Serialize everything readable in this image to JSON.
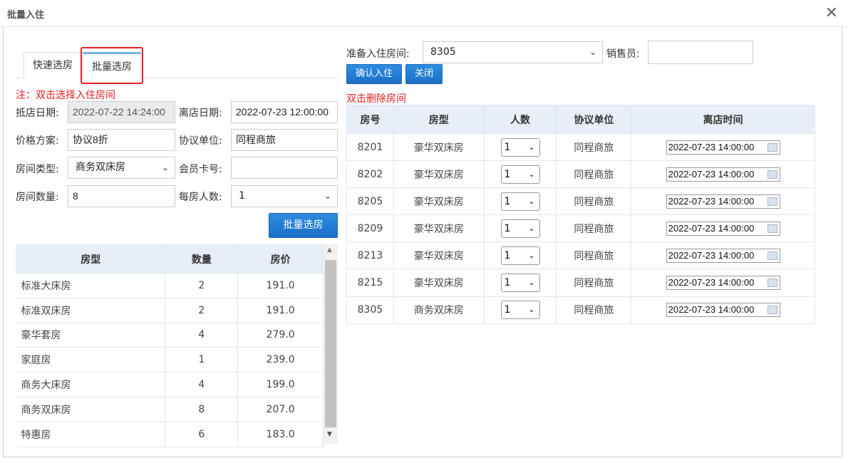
{
  "window": {
    "title": "批量入住"
  },
  "tabs": [
    {
      "label": "快速选房",
      "active": false
    },
    {
      "label": "批量选房",
      "active": true
    }
  ],
  "left": {
    "note": "注：双击选择入住房间",
    "checkin_label": "抵店日期:",
    "checkin_value": "2022-07-22 14:24:00",
    "checkout_label": "离店日期:",
    "checkout_value": "2022-07-23 12:00:00",
    "price_plan_label": "价格方案:",
    "price_plan_value": "协议8折",
    "agreement_label": "协议单位:",
    "agreement_value": "同程商旅",
    "room_type_label": "房间类型:",
    "room_type_value": "商务双床房",
    "member_card_label": "会员卡号:",
    "member_card_value": "",
    "room_count_label": "房间数量:",
    "room_count_value": "8",
    "per_room_label": "每房人数:",
    "per_room_value": "1",
    "batch_button": "批量选房",
    "table_headers": [
      "房型",
      "数量",
      "房价"
    ],
    "rows": [
      {
        "type": "标准大床房",
        "count": "2",
        "price": "191.0"
      },
      {
        "type": "标准双床房",
        "count": "2",
        "price": "191.0"
      },
      {
        "type": "豪华套房",
        "count": "4",
        "price": "279.0"
      },
      {
        "type": "家庭房",
        "count": "1",
        "price": "239.0"
      },
      {
        "type": "商务大床房",
        "count": "4",
        "price": "199.0"
      },
      {
        "type": "商务双床房",
        "count": "8",
        "price": "207.0"
      },
      {
        "type": "特惠房",
        "count": "6",
        "price": "183.0"
      }
    ]
  },
  "right": {
    "prepare_label": "准备入住房间:",
    "prepare_value": "8305",
    "sales_label": "销售员:",
    "sales_value": "",
    "confirm_button": "确认入住",
    "close_button": "关闭",
    "note": "双击删除房间",
    "table_headers": [
      "房号",
      "房型",
      "人数",
      "协议单位",
      "离店时间"
    ],
    "rows": [
      {
        "room": "8201",
        "type": "豪华双床房",
        "people": "1",
        "unit": "同程商旅",
        "checkout": "2022-07-23 14:00:00"
      },
      {
        "room": "8202",
        "type": "豪华双床房",
        "people": "1",
        "unit": "同程商旅",
        "checkout": "2022-07-23 14:00:00"
      },
      {
        "room": "8205",
        "type": "豪华双床房",
        "people": "1",
        "unit": "同程商旅",
        "checkout": "2022-07-23 14:00:00"
      },
      {
        "room": "8209",
        "type": "豪华双床房",
        "people": "1",
        "unit": "同程商旅",
        "checkout": "2022-07-23 14:00:00"
      },
      {
        "room": "8213",
        "type": "豪华双床房",
        "people": "1",
        "unit": "同程商旅",
        "checkout": "2022-07-23 14:00:00"
      },
      {
        "room": "8215",
        "type": "豪华双床房",
        "people": "1",
        "unit": "同程商旅",
        "checkout": "2022-07-23 14:00:00"
      },
      {
        "room": "8305",
        "type": "商务双床房",
        "people": "1",
        "unit": "同程商旅",
        "checkout": "2022-07-23 14:00:00"
      }
    ]
  },
  "icons": {
    "close": "close-icon",
    "calendar": "calendar-icon",
    "chevron": "chevron-down-icon"
  },
  "colors": {
    "accent": "#1a6fc8",
    "note": "#e02020",
    "highlight_box": "#e32020",
    "tab_active": "#76b6e8"
  }
}
